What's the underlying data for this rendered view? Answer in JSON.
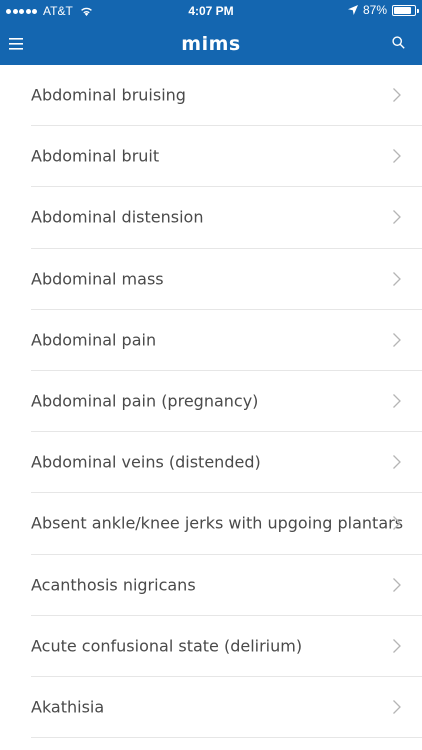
{
  "status_bar": {
    "carrier": "AT&T",
    "time": "4:07 PM",
    "battery": "87%",
    "battery_level": 0.87,
    "icons": [
      "signal-dots-icon",
      "wifi-icon",
      "location-arrow-icon",
      "battery-icon"
    ]
  },
  "navbar": {
    "logo": "mims",
    "background_color": "#1466b0",
    "icons": [
      "hamburger-menu-icon",
      "search-icon"
    ]
  },
  "list": {
    "items": [
      {
        "label": "Abdominal bruising"
      },
      {
        "label": "Abdominal bruit"
      },
      {
        "label": "Abdominal distension"
      },
      {
        "label": "Abdominal mass"
      },
      {
        "label": "Abdominal pain"
      },
      {
        "label": "Abdominal pain (pregnancy)"
      },
      {
        "label": "Abdominal veins (distended)"
      },
      {
        "label": "Absent ankle/knee jerks with upgoing plantars"
      },
      {
        "label": "Acanthosis nigricans"
      },
      {
        "label": "Acute confusional state (delirium)"
      },
      {
        "label": "Akathisia"
      }
    ]
  }
}
